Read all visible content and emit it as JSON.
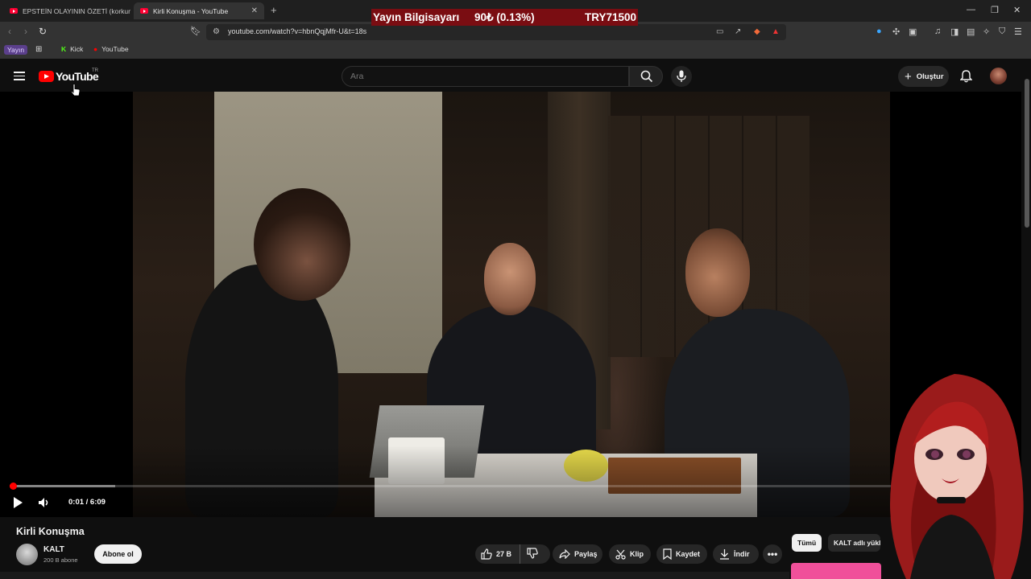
{
  "browser": {
    "tabs": [
      {
        "label": "EPSTEİN OLAYININ ÖZETİ (korkunç)",
        "active": false
      },
      {
        "label": "Kirli Konuşma - YouTube",
        "active": true
      }
    ],
    "url": "youtube.com/watch?v=hbnQqjMfr-U&t=18s",
    "bookmarks": [
      "Yayın",
      "Kick",
      "YouTube"
    ]
  },
  "stream_ticker": {
    "label": "Yayın Bilgisayarı",
    "change": "90₺ (0.13%)",
    "price": "TRY71500"
  },
  "header": {
    "logo_text": "YouTube",
    "region": "TR",
    "search_placeholder": "Ara",
    "create_label": "Oluştur"
  },
  "player": {
    "time": "0:01 / 6:09",
    "progress_fraction": 0.003,
    "buffered_fraction": 0.105
  },
  "video": {
    "title": "Kirli Konuşma",
    "channel": "KALT",
    "subscribers": "200 B abone",
    "subscribe_label": "Abone ol",
    "likes": "27 B",
    "share_label": "Paylaş",
    "clip_label": "Klip",
    "save_label": "Kaydet",
    "download_label": "İndir"
  },
  "chips": {
    "all": "Tümü",
    "channel": "KALT adlı yüklemeler"
  },
  "colors": {
    "accent": "#ff0000",
    "ticker_bg": "#7a0d12",
    "background": "#0f0f0f"
  }
}
